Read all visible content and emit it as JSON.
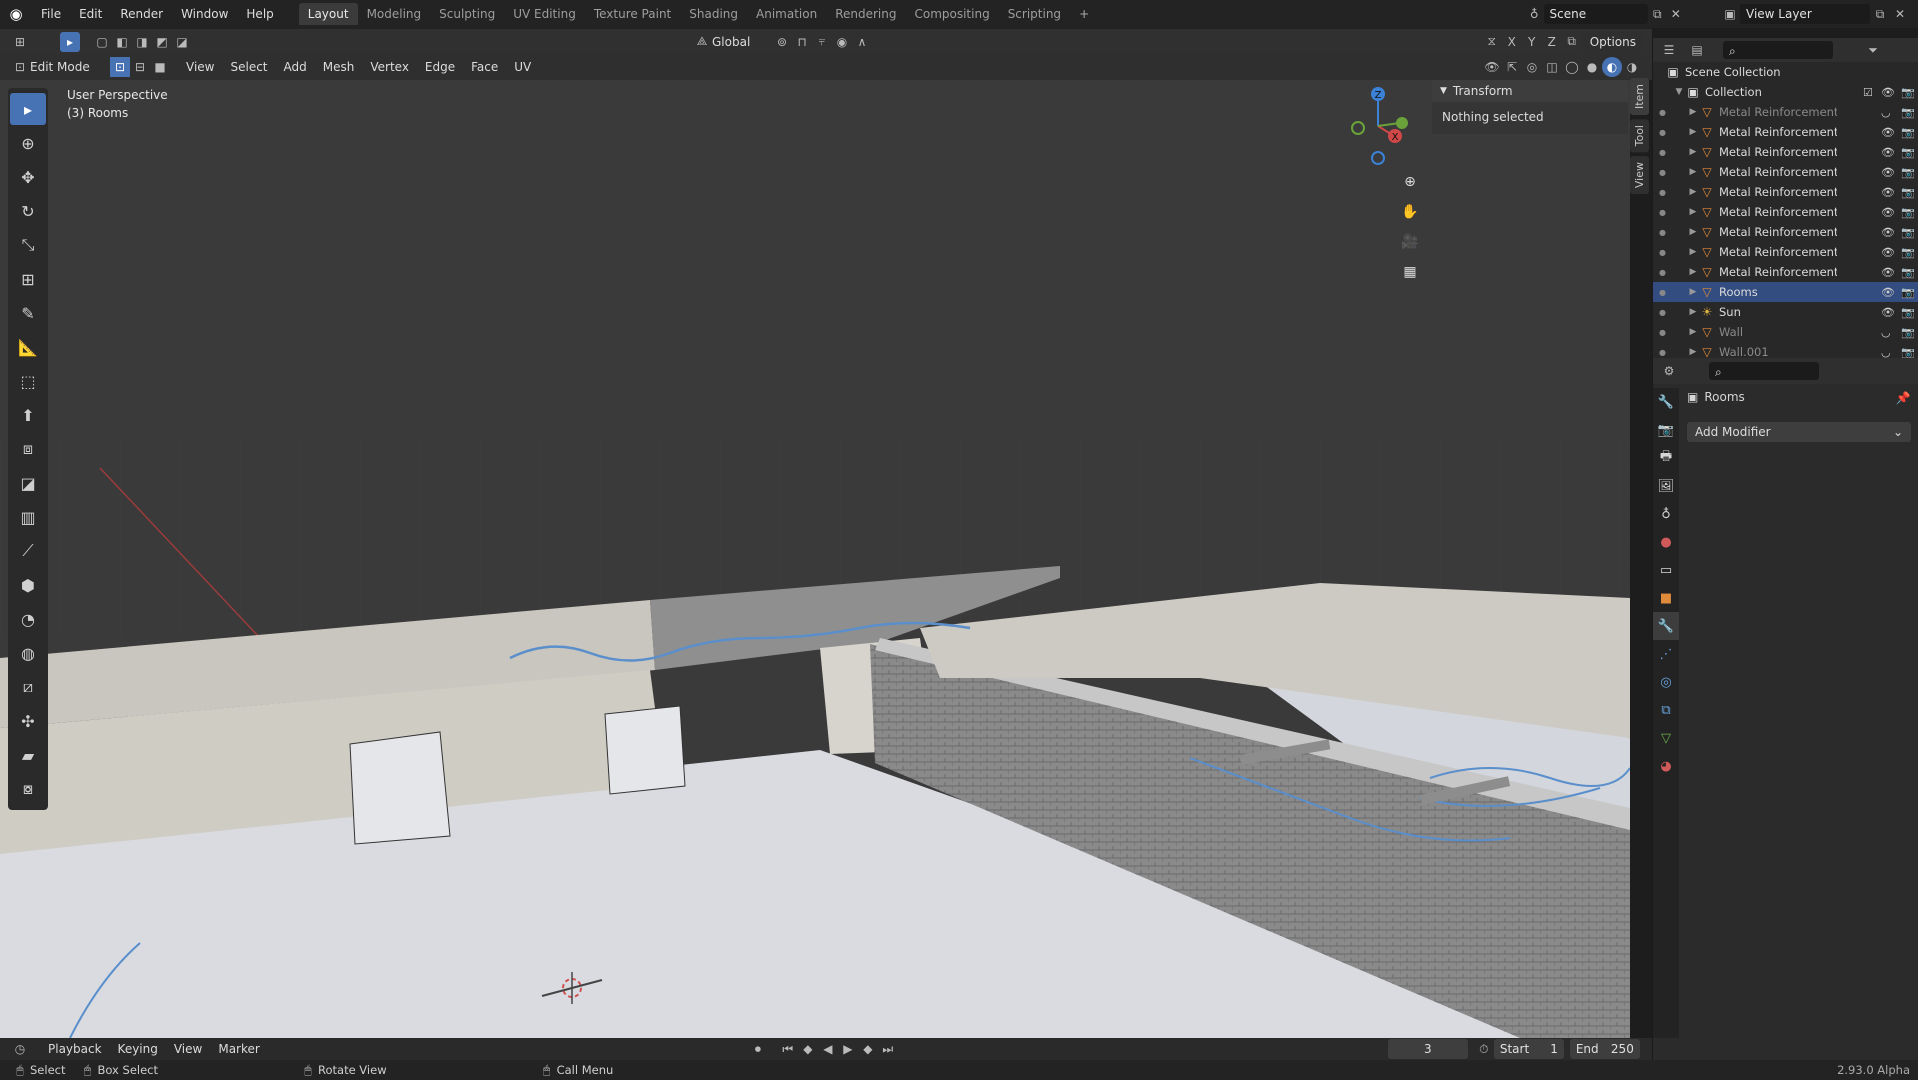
{
  "topbar": {
    "menu": [
      "File",
      "Edit",
      "Render",
      "Window",
      "Help"
    ],
    "tabs": [
      "Layout",
      "Modeling",
      "Sculpting",
      "UV Editing",
      "Texture Paint",
      "Shading",
      "Animation",
      "Rendering",
      "Compositing",
      "Scripting"
    ],
    "scene": "Scene",
    "view_layer": "View Layer"
  },
  "header": {
    "transform": "Global",
    "options": "Options",
    "mode": "Edit Mode",
    "menus": [
      "View",
      "Select",
      "Add",
      "Mesh",
      "Vertex",
      "Edge",
      "Face",
      "UV"
    ],
    "axes": [
      "X",
      "Y",
      "Z"
    ]
  },
  "viewport": {
    "perspective": "User Perspective",
    "object": "(3) Rooms"
  },
  "npanel": {
    "title": "Transform",
    "body": "Nothing selected",
    "tabs": [
      "Item",
      "Tool",
      "View"
    ]
  },
  "gizmo": {
    "z": "Z",
    "x": "X"
  },
  "outliner": {
    "root": "Scene Collection",
    "collection": "Collection",
    "items": [
      {
        "name": "Metal Reinforcement Ba",
        "dim": true
      },
      {
        "name": "Metal Reinforcement Ba",
        "dim": false
      },
      {
        "name": "Metal Reinforcement Ba",
        "dim": false
      },
      {
        "name": "Metal Reinforcement Ba",
        "dim": false
      },
      {
        "name": "Metal Reinforcement Ba",
        "dim": false
      },
      {
        "name": "Metal Reinforcement Ba",
        "dim": false
      },
      {
        "name": "Metal Reinforcement Ba",
        "dim": false
      },
      {
        "name": "Metal Reinforcement Ba",
        "dim": false
      },
      {
        "name": "Metal Reinforcement Ba",
        "dim": false
      },
      {
        "name": "Rooms",
        "dim": false,
        "selected": true
      },
      {
        "name": "Sun",
        "dim": false
      },
      {
        "name": "Wall",
        "dim": true
      },
      {
        "name": "Wall.001",
        "dim": true
      }
    ]
  },
  "properties": {
    "object": "Rooms",
    "add_modifier": "Add Modifier"
  },
  "timeline": {
    "menus": [
      "Playback",
      "Keying",
      "View",
      "Marker"
    ],
    "frame": "3",
    "start_label": "Start",
    "start": "1",
    "end_label": "End",
    "end": "250"
  },
  "status": {
    "select": "Select",
    "box_select": "Box Select",
    "rotate": "Rotate View",
    "call_menu": "Call Menu",
    "version": "2.93.0 Alpha"
  },
  "colors": {
    "accent": "#4772b3",
    "selection": "#334d80",
    "orange": "#e08a3c",
    "viewport": "#3a3a3a"
  }
}
